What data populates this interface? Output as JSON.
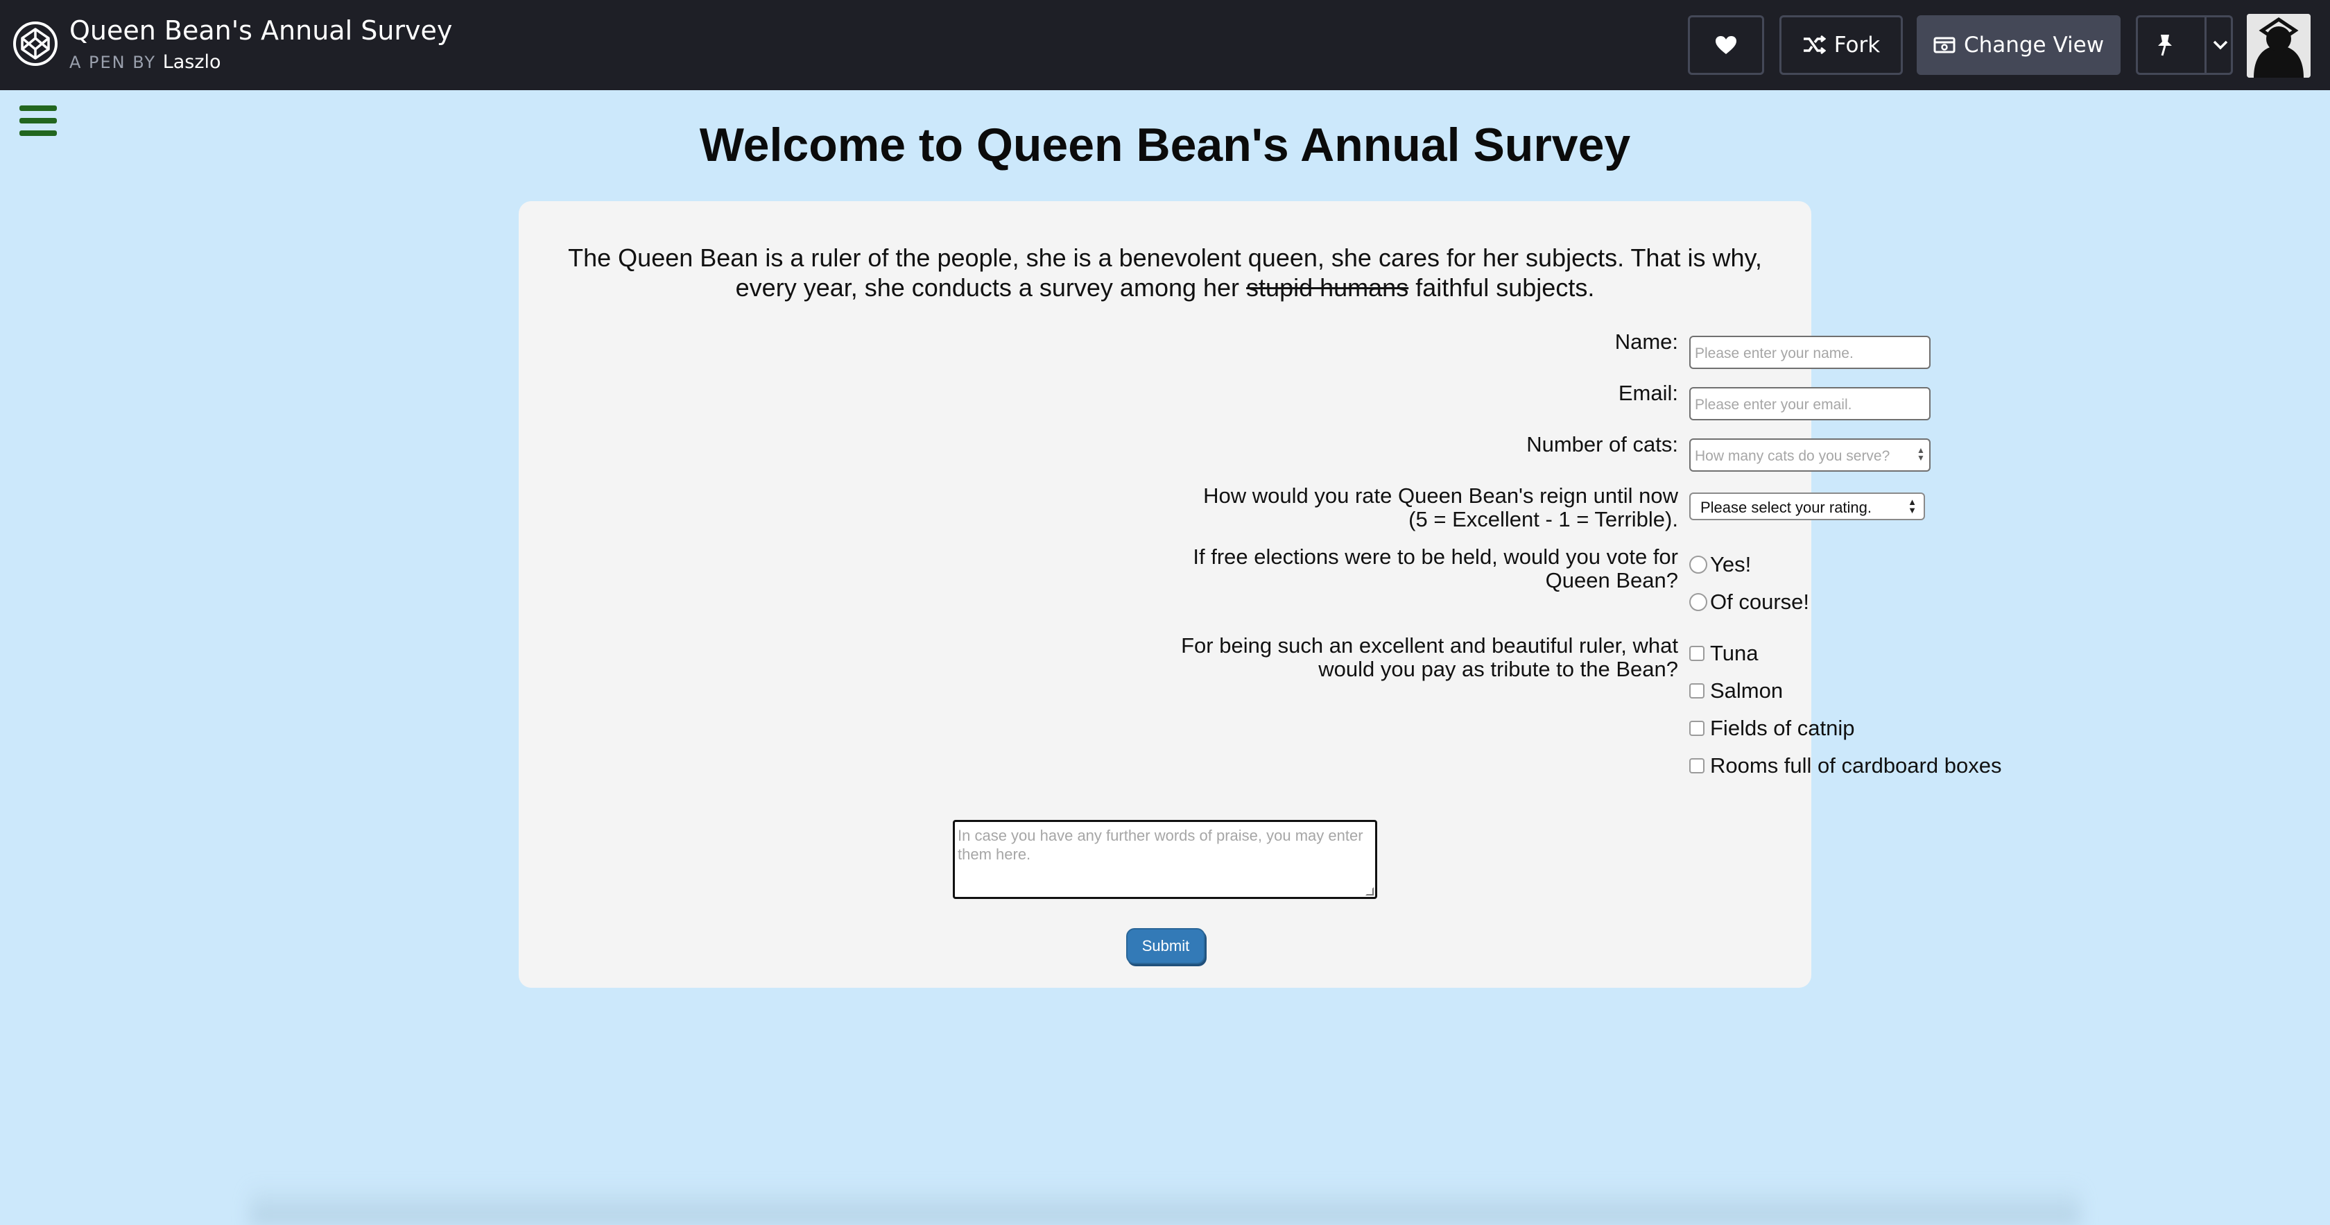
{
  "topbar": {
    "pen_title": "Queen Bean's Annual Survey",
    "pen_by_prefix": "A PEN BY",
    "author": "Laszlo",
    "fork_label": "Fork",
    "change_view_label": "Change View"
  },
  "page": {
    "title": "Welcome to Queen Bean's Annual Survey",
    "intro_before": "The Queen Bean is a ruler of the people, she is a benevolent queen, she cares for her subjects. That is why, every year, she conducts a survey among her ",
    "intro_struck": "stupid humans",
    "intro_after": " faithful subjects."
  },
  "form": {
    "name_label": "Name:",
    "name_placeholder": "Please enter your name.",
    "email_label": "Email:",
    "email_placeholder": "Please enter your email.",
    "cats_label": "Number of cats:",
    "cats_placeholder": "How many cats do you serve?",
    "rating_label_line1": "How would you rate Queen Bean's reign until now",
    "rating_label_line2": "(5 = Excellent - 1 = Terrible).",
    "rating_selected": "Please select your rating.",
    "vote_label_line1": "If free elections were to be held, would you vote for",
    "vote_label_line2": "Queen Bean?",
    "vote_options": [
      "Yes!",
      "Of course!"
    ],
    "tribute_label_line1": "For being such an excellent and beautiful ruler, what",
    "tribute_label_line2": "would you pay as tribute to the Bean?",
    "tribute_options": [
      "Tuna",
      "Salmon",
      "Fields of catnip",
      "Rooms full of cardboard boxes"
    ],
    "comments_placeholder": "In case you have any further words of praise, you may enter them here.",
    "submit_label": "Submit"
  },
  "icons": {
    "logo": "codepen-logo-icon",
    "heart": "heart-icon",
    "fork": "fork-icon",
    "view": "change-view-icon",
    "pin": "pin-icon",
    "chevron": "chevron-down-icon",
    "menu": "hamburger-menu-icon"
  },
  "colors": {
    "page_background": "#cce8fb",
    "topbar": "#1e1f26",
    "card": "#f4f4f4",
    "hamburger": "#22661f",
    "submit": "#337ab7"
  }
}
